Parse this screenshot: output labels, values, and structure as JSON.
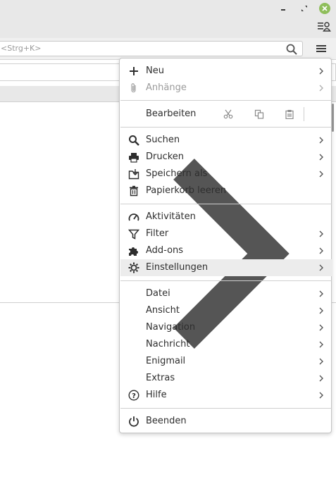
{
  "search": {
    "placeholder": "<Strg+K>"
  },
  "menu": {
    "items_top": [
      {
        "label": "Neu",
        "icon": "plus-icon",
        "submenu": true,
        "disabled": false
      },
      {
        "label": "Anhänge",
        "icon": "paperclip-icon",
        "submenu": true,
        "disabled": true
      }
    ],
    "edit": {
      "label": "Bearbeiten",
      "buttons": [
        "cut-icon",
        "copy-icon",
        "paste-icon"
      ],
      "submenu": true
    },
    "items_mid": [
      {
        "label": "Suchen",
        "icon": "search-icon",
        "submenu": true
      },
      {
        "label": "Drucken",
        "icon": "printer-icon",
        "submenu": true
      },
      {
        "label": "Speichern als",
        "icon": "save-as-icon",
        "submenu": true
      },
      {
        "label": "Papierkorb leeren",
        "icon": "trash-icon",
        "submenu": false
      }
    ],
    "items_tools": [
      {
        "label": "Aktivitäten",
        "icon": "gauge-icon",
        "submenu": false
      },
      {
        "label": "Filter",
        "icon": "funnel-icon",
        "submenu": true
      },
      {
        "label": "Add-ons",
        "icon": "puzzle-icon",
        "submenu": true
      },
      {
        "label": "Einstellungen",
        "icon": "gear-icon",
        "submenu": true,
        "hovered": true
      }
    ],
    "items_classic": [
      {
        "label": "Datei",
        "submenu": true
      },
      {
        "label": "Ansicht",
        "submenu": true
      },
      {
        "label": "Navigation",
        "submenu": true
      },
      {
        "label": "Nachricht",
        "submenu": true
      },
      {
        "label": "Enigmail",
        "submenu": true
      },
      {
        "label": "Extras",
        "submenu": true
      },
      {
        "label": "Hilfe",
        "icon": "help-icon",
        "submenu": true
      }
    ],
    "quit": {
      "label": "Beenden",
      "icon": "power-icon"
    }
  }
}
